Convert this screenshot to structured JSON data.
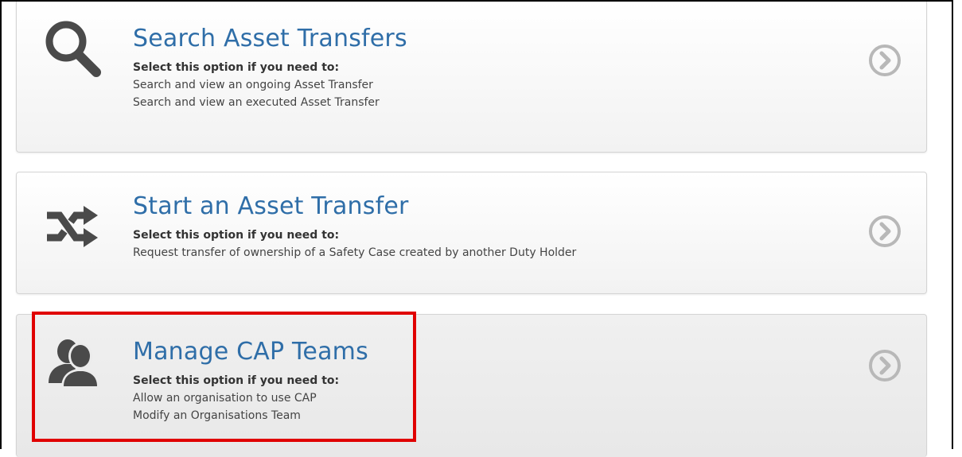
{
  "cards": [
    {
      "title": "Search Asset Transfers",
      "subtitle": "Select this option if you need to:",
      "lines": [
        "Search and view an ongoing Asset Transfer",
        "Search and view an executed Asset Transfer"
      ],
      "icon": "magnifier-icon"
    },
    {
      "title": "Start an Asset Transfer",
      "subtitle": "Select this option if you need to:",
      "lines": [
        "Request transfer of ownership of a Safety Case created by another Duty Holder"
      ],
      "icon": "shuffle-icon"
    },
    {
      "title": "Manage CAP Teams",
      "subtitle": "Select this option if you need to:",
      "lines": [
        "Allow an organisation to use CAP",
        "Modify an Organisations Team"
      ],
      "icon": "users-icon"
    }
  ],
  "colors": {
    "title": "#2f6ea8",
    "icon": "#4a4a4a",
    "chevron": "#b8b8b8",
    "highlight": "#e00000"
  }
}
